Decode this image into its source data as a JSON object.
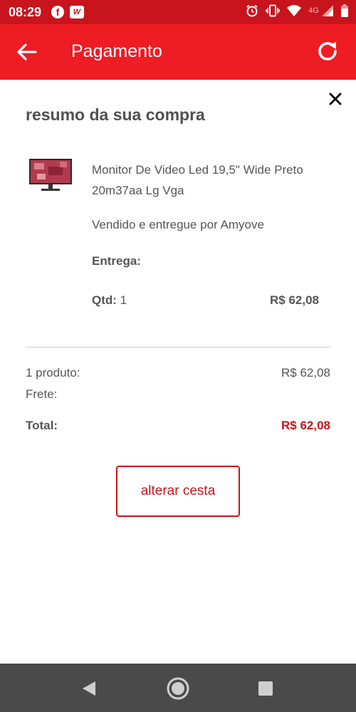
{
  "status_bar": {
    "time": "08:29",
    "network": "4G",
    "app_icons": [
      "facebook-icon",
      "app-icon"
    ],
    "right_icons": [
      "alarm-icon",
      "vibrate-icon",
      "wifi-icon",
      "signal-icon",
      "battery-icon"
    ]
  },
  "app_bar": {
    "title": "Pagamento",
    "left_icon": "back-arrow-icon",
    "right_icon": "refresh-icon",
    "color": "#ee1c23"
  },
  "summary": {
    "title": "resumo da sua compra",
    "close_icon": "close-icon",
    "product": {
      "name": "Monitor De Video Led 19,5\" Wide Preto 20m37aa Lg Vga",
      "seller": "Vendido e entregue por Amyove",
      "delivery_label": "Entrega:",
      "qty_label": "Qtd:",
      "qty_value": "1",
      "price": "R$ 62,08",
      "image_icon": "monitor-thumbnail"
    },
    "totals": {
      "count_label": "1 produto:",
      "count_price": "R$ 62,08",
      "shipping_label": "Frete:",
      "total_label": "Total:",
      "total_value": "R$ 62,08"
    },
    "alter_button": "alterar cesta",
    "accent": "#c8141c"
  },
  "nav_bar": {
    "icons": [
      "nav-back-icon",
      "nav-home-icon",
      "nav-recents-icon"
    ]
  }
}
